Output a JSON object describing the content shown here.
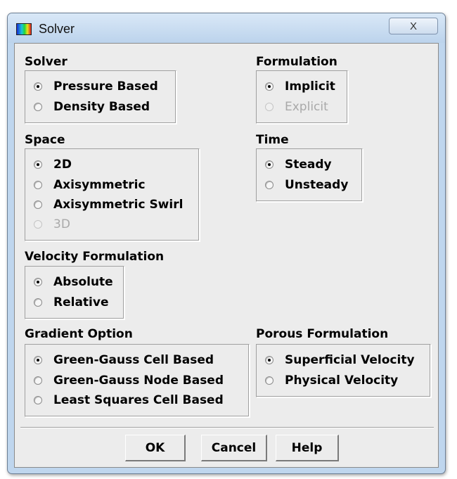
{
  "window": {
    "title": "Solver",
    "close_glyph": "X",
    "icon": "fluent-app-icon"
  },
  "solver": {
    "label": "Solver",
    "options": [
      {
        "label": "Pressure Based",
        "selected": true,
        "enabled": true
      },
      {
        "label": "Density Based",
        "selected": false,
        "enabled": true
      }
    ]
  },
  "formulation": {
    "label": "Formulation",
    "options": [
      {
        "label": "Implicit",
        "selected": true,
        "enabled": true
      },
      {
        "label": "Explicit",
        "selected": false,
        "enabled": false
      }
    ]
  },
  "space": {
    "label": "Space",
    "options": [
      {
        "label": "2D",
        "selected": true,
        "enabled": true
      },
      {
        "label": "Axisymmetric",
        "selected": false,
        "enabled": true
      },
      {
        "label": "Axisymmetric Swirl",
        "selected": false,
        "enabled": true
      },
      {
        "label": "3D",
        "selected": false,
        "enabled": false
      }
    ]
  },
  "time": {
    "label": "Time",
    "options": [
      {
        "label": "Steady",
        "selected": true,
        "enabled": true
      },
      {
        "label": "Unsteady",
        "selected": false,
        "enabled": true
      }
    ]
  },
  "velocity_formulation": {
    "label": "Velocity Formulation",
    "options": [
      {
        "label": "Absolute",
        "selected": true,
        "enabled": true
      },
      {
        "label": "Relative",
        "selected": false,
        "enabled": true
      }
    ]
  },
  "gradient_option": {
    "label": "Gradient Option",
    "options": [
      {
        "label": "Green-Gauss Cell Based",
        "selected": true,
        "enabled": true
      },
      {
        "label": "Green-Gauss Node Based",
        "selected": false,
        "enabled": true
      },
      {
        "label": "Least Squares Cell Based",
        "selected": false,
        "enabled": true
      }
    ]
  },
  "porous_formulation": {
    "label": "Porous Formulation",
    "options": [
      {
        "label": "Superficial Velocity",
        "selected": true,
        "enabled": true
      },
      {
        "label": "Physical Velocity",
        "selected": false,
        "enabled": true
      }
    ]
  },
  "buttons": {
    "ok": "OK",
    "cancel": "Cancel",
    "help": "Help"
  }
}
